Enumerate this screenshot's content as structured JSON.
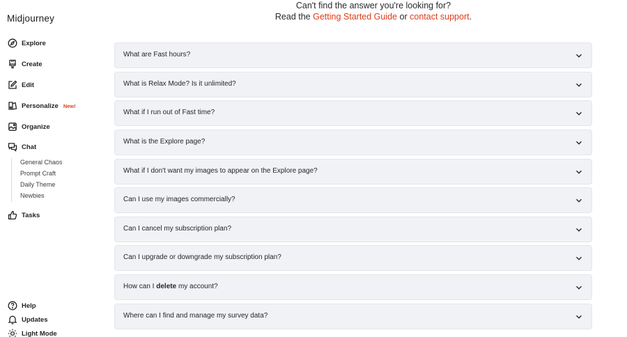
{
  "app": {
    "brand": "Midjourney"
  },
  "sidebar": {
    "nav": [
      {
        "label": "Explore",
        "icon": "compass-icon"
      },
      {
        "label": "Create",
        "icon": "brush-icon"
      },
      {
        "label": "Edit",
        "icon": "edit-icon"
      },
      {
        "label": "Personalize",
        "icon": "personalize-icon",
        "badge": "New!"
      },
      {
        "label": "Organize",
        "icon": "image-icon"
      },
      {
        "label": "Chat",
        "icon": "chat-icon"
      },
      {
        "label": "Tasks",
        "icon": "thumbs-up-icon"
      }
    ],
    "chat_rooms": [
      "General Chaos",
      "Prompt Craft",
      "Daily Theme",
      "Newbies"
    ],
    "footer": [
      {
        "label": "Help",
        "icon": "help-icon"
      },
      {
        "label": "Updates",
        "icon": "bell-icon"
      },
      {
        "label": "Light Mode",
        "icon": "sun-icon"
      }
    ]
  },
  "help": {
    "line1": "Can't find the answer you're looking for?",
    "read_the": "Read the",
    "guide_link": "Getting Started Guide",
    "or": "or",
    "support_link": "contact support",
    "period": "."
  },
  "faq": [
    {
      "q": "What are Fast hours?"
    },
    {
      "q": "What is Relax Mode? Is it unlimited?"
    },
    {
      "q": "What if I run out of Fast time?"
    },
    {
      "q": "What is the Explore page?"
    },
    {
      "q": "What if I don't want my images to appear on the Explore page?"
    },
    {
      "q": "Can I use my images commercially?"
    },
    {
      "q": "Can I cancel my subscription plan?"
    },
    {
      "q": "Can I upgrade or downgrade my subscription plan?"
    },
    {
      "q_before": "How can I",
      "q_bold": "delete",
      "q_after": "my account?"
    },
    {
      "q": "Where can I find and manage my survey data?"
    }
  ],
  "colors": {
    "accent": "#df3b17",
    "badge": "#e0401c",
    "card_bg": "#f1f2f5"
  }
}
